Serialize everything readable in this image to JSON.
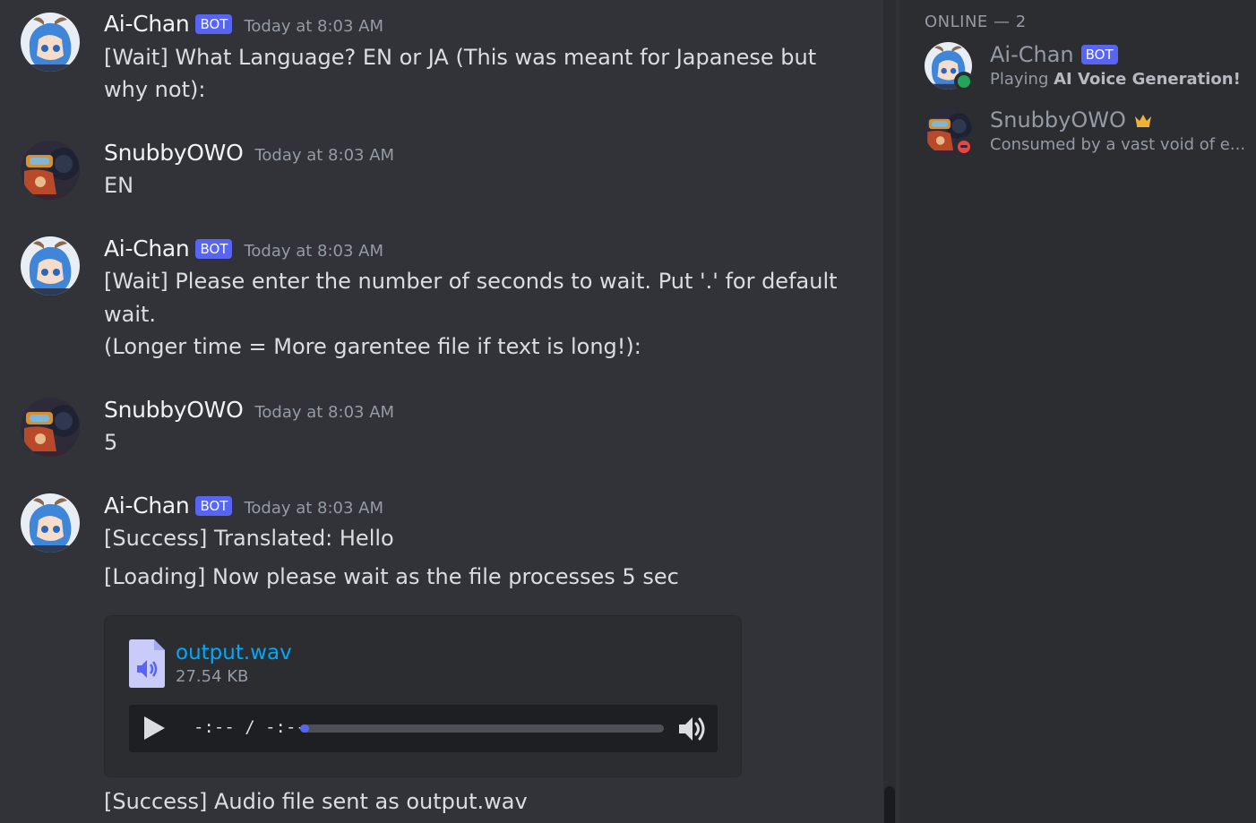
{
  "messages": [
    {
      "author": "Ai-Chan",
      "bot_tag": "BOT",
      "time": "Today at 8:03 AM",
      "lines": [
        "[Wait] What Language? EN or JA (This was meant for Japanese but",
        "why not):"
      ]
    },
    {
      "author": "SnubbyOWO",
      "time": "Today at 8:03 AM",
      "lines": [
        "EN"
      ]
    },
    {
      "author": "Ai-Chan",
      "bot_tag": "BOT",
      "time": "Today at 8:03 AM",
      "lines": [
        "[Wait] Please enter the number of seconds to wait. Put '.' for default",
        "wait.",
        "(Longer time = More garentee file if text is long!):"
      ]
    },
    {
      "author": "SnubbyOWO",
      "time": "Today at 8:03 AM",
      "lines": [
        "5"
      ]
    },
    {
      "author": "Ai-Chan",
      "bot_tag": "BOT",
      "time": "Today at 8:03 AM",
      "lines": [
        "[Success] Translated: Hello",
        "[Loading] Now please wait as the file processes 5 sec",
        "[Success] Audio file sent as output.wav"
      ]
    }
  ],
  "attachment": {
    "file_name": "output.wav",
    "file_size": "27.54 KB",
    "player_time": "-:-- / -:--",
    "progress_fraction": 0.02
  },
  "members": {
    "header": "ONLINE — 2",
    "list": [
      {
        "name": "Ai-Chan",
        "bot_tag": "BOT",
        "status_prefix": "Playing ",
        "status_bold": "AI Voice Generation!",
        "presence": "online",
        "presence_color": "#23a55a"
      },
      {
        "name": "SnubbyOWO",
        "crown": "crown-icon",
        "status_prefix": "Consumed by a vast void of e...",
        "status_bold": "",
        "presence": "dnd",
        "presence_color": "#f23f43"
      }
    ]
  },
  "colors": {
    "accent": "#5865f2",
    "link": "#00a8fc",
    "background": "#313338",
    "sidebar": "#2b2d31"
  }
}
